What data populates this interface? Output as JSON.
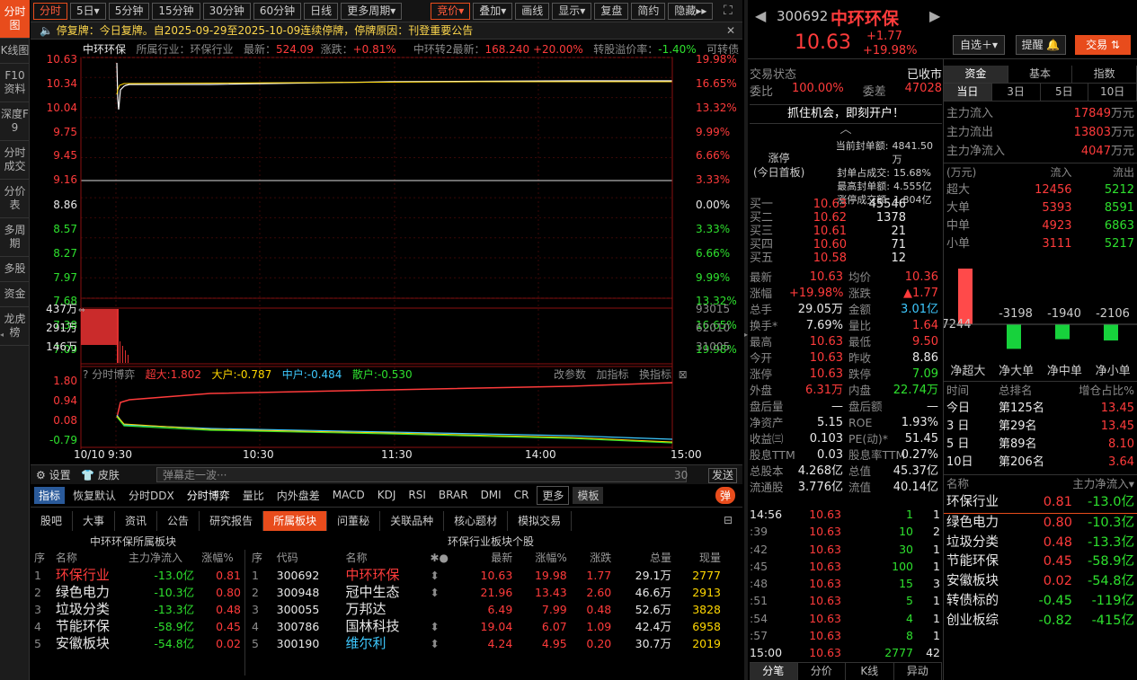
{
  "nav": [
    "分时图",
    "K线图",
    "F10资料",
    "深度F9",
    "分时成交",
    "分价表",
    "多周期",
    "多股",
    "资金",
    "龙虎榜"
  ],
  "toolbar": {
    "left": [
      "分时",
      "5日▾",
      "5分钟",
      "15分钟",
      "30分钟",
      "60分钟",
      "日线",
      "更多周期▾"
    ],
    "right": [
      "竞价▾",
      "叠加▾",
      "画线",
      "显示▾",
      "复盘",
      "简约",
      "隐藏▸▸"
    ]
  },
  "notice": "停复牌：今日复牌。自2025-09-29至2025-10-09连续停牌，停牌原因：刊登重要公告",
  "chart_info": {
    "name": "中环环保",
    "industry": "所属行业：环保行业",
    "latest_label": "最新：",
    "latest": "524.09",
    "chg_label": "涨跌：",
    "chg": "+0.81%",
    "cb_label": "中环转2最新：",
    "cb": "168.240",
    "cb_chg": "+20.00%",
    "premium_label": "转股溢价率：",
    "premium": "-1.40%",
    "cb_tag": "可转债"
  },
  "price_axis": {
    "left": [
      "10.63",
      "10.34",
      "10.04",
      "9.75",
      "9.45",
      "9.16",
      "8.86",
      "8.57",
      "8.27",
      "7.97",
      "7.68",
      "7.38",
      "7.09"
    ],
    "right": [
      "19.98%",
      "16.65%",
      "13.32%",
      "9.99%",
      "6.66%",
      "3.33%",
      "0.00%",
      "3.33%",
      "6.66%",
      "9.99%",
      "13.32%",
      "16.65%",
      "19.98%"
    ]
  },
  "vol_axis": {
    "left": [
      "437万",
      "291万",
      "146万"
    ],
    "right": [
      "93015",
      "62010",
      "31005"
    ]
  },
  "game": {
    "label": "分时博弈",
    "super": "超大:1.802",
    "big": "大户:-0.787",
    "mid": "中户:-0.484",
    "small": "散户:-0.530",
    "btns": [
      "改参数",
      "加指标",
      "换指标"
    ],
    "axis": [
      "1.80",
      "0.94",
      "0.08",
      "-0.79"
    ]
  },
  "time_axis": [
    "10/10",
    "9:30",
    "10:30",
    "11:30",
    "14:00",
    "15:00"
  ],
  "bottom_bar": {
    "settings": "设置",
    "skin": "皮肤",
    "danmu": "弹幕走一波···",
    "count": "30",
    "send": "发送"
  },
  "ind_tabs": [
    "指标",
    "恢复默认",
    "分时DDX",
    "分时博弈",
    "量比",
    "内外盘差",
    "MACD",
    "KDJ",
    "RSI",
    "BRAR",
    "DMI",
    "CR",
    "更多",
    "模板",
    "弹"
  ],
  "info_tabs": [
    "股吧",
    "大事",
    "资讯",
    "公告",
    "研究报告",
    "所属板块",
    "问董秘",
    "关联品种",
    "核心题材",
    "模拟交易"
  ],
  "block_title": "中环环保所属板块",
  "six_title": "环保行业板块个股",
  "block_head": [
    "序",
    "名称",
    "主力净流入",
    "涨幅%"
  ],
  "blocks": [
    [
      "1",
      "环保行业",
      "-13.0亿",
      "0.81"
    ],
    [
      "2",
      "绿色电力",
      "-10.3亿",
      "0.80"
    ],
    [
      "3",
      "垃圾分类",
      "-13.3亿",
      "0.48"
    ],
    [
      "4",
      "节能环保",
      "-58.9亿",
      "0.45"
    ],
    [
      "5",
      "安徽板块",
      "-54.8亿",
      "0.02"
    ]
  ],
  "stock_head": [
    "序",
    "代码",
    "名称",
    "✱●",
    "最新",
    "涨幅%",
    "涨跌",
    "总量",
    "现量"
  ],
  "stocks": [
    [
      "1",
      "300692",
      "中环环保",
      "⬍",
      "10.63",
      "19.98",
      "1.77",
      "29.1万",
      "2777"
    ],
    [
      "2",
      "300948",
      "冠中生态",
      "⬍",
      "21.96",
      "13.43",
      "2.60",
      "46.6万",
      "2913"
    ],
    [
      "3",
      "300055",
      "万邦达",
      "",
      "6.49",
      "7.99",
      "0.48",
      "52.6万",
      "3828"
    ],
    [
      "4",
      "300786",
      "国林科技",
      "⬍",
      "19.04",
      "6.07",
      "1.09",
      "42.4万",
      "6958"
    ],
    [
      "5",
      "300190",
      "维尔利",
      "⬍",
      "4.24",
      "4.95",
      "0.20",
      "30.7万",
      "2019"
    ]
  ],
  "quote": {
    "code": "300692",
    "name": "中环环保",
    "price": "10.63",
    "chg": "+1.77",
    "pct": "+19.98%",
    "btn_zx": "自选＋▾",
    "btn_tx": "提醒 🔔",
    "btn_jy": "交易 ⇅"
  },
  "status": {
    "label": "交易状态",
    "value": "已收市",
    "wb_label": "委比",
    "wb": "100.00%",
    "wc_label": "委差",
    "wc": "47028"
  },
  "promo": "抓住机会，即刻开户！",
  "limit": {
    "tag1": "涨停",
    "tag2": "(今日首板)",
    "rows": [
      [
        "当前封单额:",
        "4841.50万"
      ],
      [
        "封单占成交:",
        "15.68%"
      ],
      [
        "最高封单额:",
        "4.555亿"
      ],
      [
        "涨停成交额:",
        "1.804亿"
      ]
    ]
  },
  "bids": [
    [
      "买一",
      "10.63",
      "45546"
    ],
    [
      "买二",
      "10.62",
      "1378"
    ],
    [
      "买三",
      "10.61",
      "21"
    ],
    [
      "买四",
      "10.60",
      "71"
    ],
    [
      "买五",
      "10.58",
      "12"
    ]
  ],
  "stats": [
    [
      "最新",
      "10.63",
      "均价",
      "10.36"
    ],
    [
      "涨幅",
      "+19.98%",
      "涨跌",
      "▲1.77"
    ],
    [
      "总手",
      "29.05万",
      "金额",
      "3.01亿"
    ],
    [
      "换手*",
      "7.69%",
      "量比",
      "1.64"
    ],
    [
      "最高",
      "10.63",
      "最低",
      "9.50"
    ],
    [
      "今开",
      "10.63",
      "昨收",
      "8.86"
    ],
    [
      "涨停",
      "10.63",
      "跌停",
      "7.09"
    ],
    [
      "外盘",
      "6.31万",
      "内盘",
      "22.74万"
    ],
    [
      "盘后量",
      "—",
      "盘后额",
      "—"
    ],
    [
      "净资产",
      "5.15",
      "ROE",
      "1.93%"
    ],
    [
      "收益㈢",
      "0.103",
      "PE(动)*",
      "51.45"
    ],
    [
      "股息TTM",
      "0.03",
      "股息率TTM",
      "0.27%"
    ],
    [
      "总股本",
      "4.268亿",
      "总值",
      "45.37亿"
    ],
    [
      "流通股",
      "3.776亿",
      "流值",
      "40.14亿"
    ]
  ],
  "ticks": [
    [
      "14:56",
      "10.63",
      "1",
      "1"
    ],
    [
      ":39",
      "10.63",
      "10",
      "2"
    ],
    [
      ":42",
      "10.63",
      "30",
      "1"
    ],
    [
      ":45",
      "10.63",
      "100",
      "1"
    ],
    [
      ":48",
      "10.63",
      "15",
      "3"
    ],
    [
      ":51",
      "10.63",
      "5",
      "1"
    ],
    [
      ":54",
      "10.63",
      "4",
      "1"
    ],
    [
      ":57",
      "10.63",
      "8",
      "1"
    ],
    [
      "15:00",
      "10.63",
      "2777",
      "42"
    ]
  ],
  "tick_tabs": [
    "分笔",
    "分价",
    "K线",
    "异动"
  ],
  "fund_tabs": [
    "资金",
    "基本",
    "指数"
  ],
  "period_tabs": [
    "当日",
    "3日",
    "5日",
    "10日"
  ],
  "main_flow": [
    [
      "主力流入",
      "17849",
      "万元"
    ],
    [
      "主力流出",
      "13803",
      "万元"
    ],
    [
      "主力净流入",
      "4047",
      "万元"
    ]
  ],
  "flow_head": [
    "(万元)",
    "流入",
    "流出"
  ],
  "flow": [
    [
      "超大",
      "12456",
      "5212"
    ],
    [
      "大单",
      "5393",
      "8591"
    ],
    [
      "中单",
      "4923",
      "6863"
    ],
    [
      "小单",
      "3111",
      "5217"
    ]
  ],
  "net_bars": [
    {
      "label": "净超大",
      "value": 7244
    },
    {
      "label": "净大单",
      "value": -3198
    },
    {
      "label": "净中单",
      "value": -1940
    },
    {
      "label": "净小单",
      "value": -2106
    }
  ],
  "rank_head": [
    "时间",
    "总排名",
    "增仓占比%"
  ],
  "ranks": [
    [
      "今日",
      "第125名",
      "13.45"
    ],
    [
      "3 日",
      "第29名",
      "13.45"
    ],
    [
      "5 日",
      "第89名",
      "8.10"
    ],
    [
      "10日",
      "第206名",
      "3.64"
    ]
  ],
  "rblock_head": [
    "名称",
    "主力净流入▾"
  ],
  "rblocks": [
    [
      "环保行业",
      "0.81",
      "-13.0亿"
    ],
    [
      "绿色电力",
      "0.80",
      "-10.3亿"
    ],
    [
      "垃圾分类",
      "0.48",
      "-13.3亿"
    ],
    [
      "节能环保",
      "0.45",
      "-58.9亿"
    ],
    [
      "安徽板块",
      "0.02",
      "-54.8亿"
    ],
    [
      "转债标的",
      "-0.45",
      "-119亿"
    ],
    [
      "创业板综",
      "-0.82",
      "-415亿"
    ]
  ]
}
